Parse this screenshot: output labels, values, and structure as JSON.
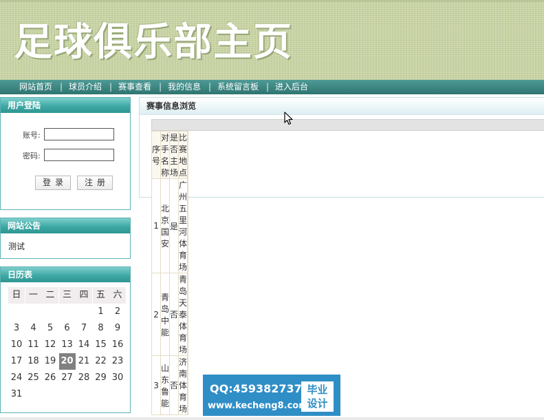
{
  "header": {
    "site_title": "足球俱乐部主页"
  },
  "nav": {
    "items": [
      "网站首页",
      "球员介绍",
      "赛事查看",
      "我的信息",
      "系统留言板",
      "进入后台"
    ],
    "separator": "|"
  },
  "login": {
    "title": "用户登陆",
    "account_label": "账号:",
    "password_label": "密码:",
    "account_value": "",
    "password_value": "",
    "login_button": "登录",
    "register_button": "注册"
  },
  "notice": {
    "title": "网站公告",
    "text": "测试"
  },
  "calendar": {
    "title": "日历表",
    "weekdays": [
      "日",
      "一",
      "二",
      "三",
      "四",
      "五",
      "六"
    ],
    "first_weekday_index": 5,
    "days_in_month": 31,
    "today": 20
  },
  "main": {
    "title": "赛事信息浏览",
    "table": {
      "headers": [
        "序号",
        "对手名称",
        "是否主场",
        "比赛地点"
      ],
      "rows": [
        [
          "1",
          "北京国安",
          "是",
          "广州五里河体育场"
        ],
        [
          "2",
          "青岛中能",
          "否",
          "青岛天泰体育场"
        ],
        [
          "3",
          "山东鲁能",
          "否",
          "济南体育场"
        ]
      ]
    }
  },
  "watermark": {
    "qq": "QQ:459382737",
    "url": "www.kecheng8.com",
    "badge_line1": "毕业",
    "badge_line2": "设计"
  },
  "colors": {
    "banner": "#c8d3a3",
    "nav": "#2f7571",
    "panel_header": "#3fa9a6",
    "watermark": "#2f8ec6",
    "today_highlight": "#808080"
  }
}
